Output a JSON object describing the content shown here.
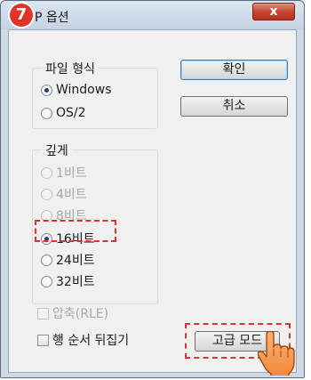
{
  "window": {
    "title_partial": "P 옵션",
    "step_number": "7",
    "close_label": "x"
  },
  "file_format": {
    "legend": "파일 형식",
    "options": [
      {
        "label": "Windows",
        "checked": true,
        "enabled": true
      },
      {
        "label": "OS/2",
        "checked": false,
        "enabled": true
      }
    ]
  },
  "depth": {
    "legend": "깊게",
    "options": [
      {
        "label": "1비트",
        "checked": false,
        "enabled": false
      },
      {
        "label": "4비트",
        "checked": false,
        "enabled": false
      },
      {
        "label": "8비트",
        "checked": false,
        "enabled": false
      },
      {
        "label": "16비트",
        "checked": true,
        "enabled": true
      },
      {
        "label": "24비트",
        "checked": false,
        "enabled": true
      },
      {
        "label": "32비트",
        "checked": false,
        "enabled": true
      }
    ]
  },
  "checkboxes": {
    "compress": {
      "label": "압축(RLE)",
      "checked": false,
      "enabled": false
    },
    "flip_rows": {
      "label": "행 순서 뒤집기",
      "checked": false,
      "enabled": true
    }
  },
  "buttons": {
    "ok": "확인",
    "cancel": "취소",
    "advanced": "고급 모드"
  },
  "colors": {
    "highlight": "#e03030",
    "badge": "#e0342b",
    "close": "#c7402f"
  }
}
